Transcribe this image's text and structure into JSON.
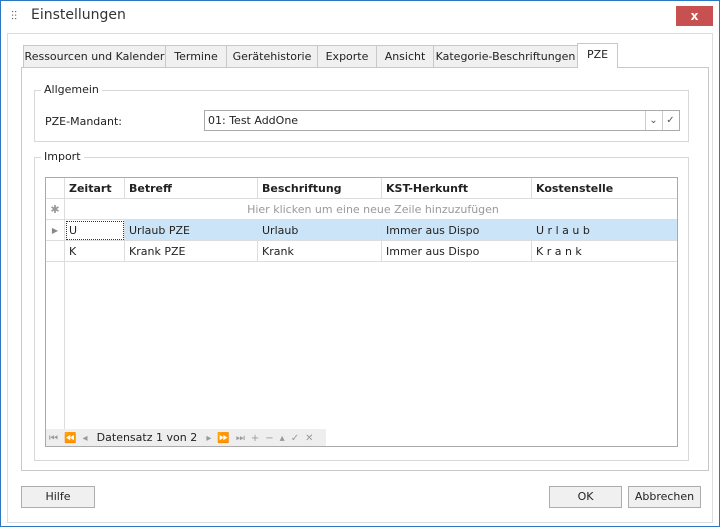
{
  "window": {
    "title": "Einstellungen",
    "close": "x"
  },
  "tabs": [
    "Ressourcen und Kalender",
    "Termine",
    "Gerätehistorie",
    "Exporte",
    "Ansicht",
    "Kategorie-Beschriftungen",
    "PZE"
  ],
  "active_tab": "PZE",
  "allgemein": {
    "label": "Allgemein",
    "mandant_label": "PZE-Mandant:",
    "mandant_value": "01: Test AddOne"
  },
  "import": {
    "label": "Import",
    "columns": [
      "Zeitart",
      "Betreff",
      "Beschriftung",
      "KST-Herkunft",
      "Kostenstelle"
    ],
    "new_row_hint": "Hier klicken um eine neue Zeile hinzuzufügen",
    "rows": [
      [
        "U",
        "Urlaub PZE",
        "Urlaub",
        "Immer aus Dispo",
        "U r l a u b"
      ],
      [
        "K",
        "Krank PZE",
        "Krank",
        "Immer aus Dispo",
        "K r a n k"
      ]
    ],
    "navigator": "Datensatz 1 von 2"
  },
  "buttons": {
    "help": "Hilfe",
    "ok": "OK",
    "cancel": "Abbrechen"
  },
  "colors": {
    "selected_row": "#cce4f7",
    "close": "#c75050"
  }
}
